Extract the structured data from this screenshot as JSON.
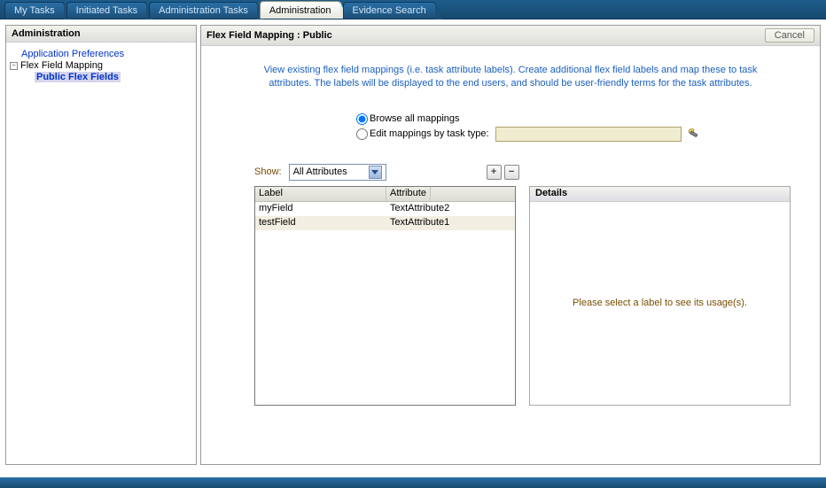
{
  "tabs": [
    {
      "label": "My Tasks",
      "active": false
    },
    {
      "label": "Initiated Tasks",
      "active": false
    },
    {
      "label": "Administration Tasks",
      "active": false
    },
    {
      "label": "Administration",
      "active": true
    },
    {
      "label": "Evidence Search",
      "active": false
    }
  ],
  "sidebar": {
    "title": "Administration",
    "links": {
      "app_pref": "Application Preferences",
      "flex": "Flex Field Mapping",
      "public_flex": "Public Flex Fields"
    }
  },
  "header": {
    "title": "Flex Field Mapping : Public",
    "cancel": "Cancel"
  },
  "intro": "View existing flex field mappings (i.e. task attribute labels). Create additional flex field labels and map these to task attributes. The labels will be displayed to the end users, and should be user-friendly terms for the task attributes.",
  "radios": {
    "browse": "Browse all mappings",
    "edit": "Edit mappings by task type:"
  },
  "tasktype_value": "",
  "show": {
    "label": "Show:",
    "selected": "All Attributes"
  },
  "plusminus": {
    "plus": "+",
    "minus": "−"
  },
  "table": {
    "columns": {
      "label": "Label",
      "attribute": "Attribute"
    },
    "rows": [
      {
        "label": "myField",
        "attribute": "TextAttribute2"
      },
      {
        "label": "testField",
        "attribute": "TextAttribute1"
      }
    ]
  },
  "details": {
    "title": "Details",
    "empty": "Please select a label to see its usage(s)."
  }
}
